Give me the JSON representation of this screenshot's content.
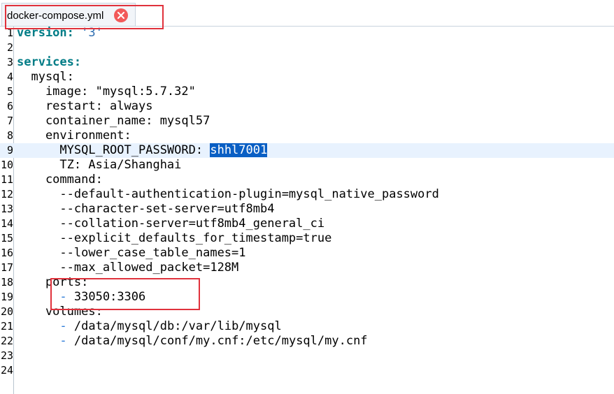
{
  "tab": {
    "label": "docker-compose.yml",
    "close_icon": "close-circle-icon"
  },
  "colors": {
    "selection": "#0a5fc4",
    "current_line": "#e8f2fe",
    "annotation_box": "#e0323c"
  },
  "lines": [
    {
      "n": "1",
      "indent": "",
      "key": "version:",
      "rest": " ",
      "str": "'3'"
    },
    {
      "n": "2",
      "text": ""
    },
    {
      "n": "3",
      "key": "services:"
    },
    {
      "n": "4",
      "text": "  mysql:"
    },
    {
      "n": "5",
      "text": "    image: \"mysql:5.7.32\""
    },
    {
      "n": "6",
      "text": "    restart: always"
    },
    {
      "n": "7",
      "text": "    container_name: mysql57"
    },
    {
      "n": "8",
      "text": "    environment:"
    },
    {
      "n": "9",
      "text": "      MYSQL_ROOT_PASSWORD: ",
      "selected": "shhl7001"
    },
    {
      "n": "10",
      "text": "      TZ: Asia/Shanghai"
    },
    {
      "n": "11",
      "text": "    command:"
    },
    {
      "n": "12",
      "text": "      --default-authentication-plugin=mysql_native_password"
    },
    {
      "n": "13",
      "text": "      --character-set-server=utf8mb4"
    },
    {
      "n": "14",
      "text": "      --collation-server=utf8mb4_general_ci"
    },
    {
      "n": "15",
      "text": "      --explicit_defaults_for_timestamp=true"
    },
    {
      "n": "16",
      "text": "      --lower_case_table_names=1"
    },
    {
      "n": "17",
      "text": "      --max_allowed_packet=128M"
    },
    {
      "n": "18",
      "text": "    ports:"
    },
    {
      "n": "19",
      "indent": "      ",
      "dash": "-",
      "after": " 33050:3306"
    },
    {
      "n": "20",
      "text": "    volumes:"
    },
    {
      "n": "21",
      "indent": "      ",
      "dash": "-",
      "after": " /data/mysql/db:/var/lib/mysql"
    },
    {
      "n": "22",
      "indent": "      ",
      "dash": "-",
      "after": " /data/mysql/conf/my.cnf:/etc/mysql/my.cnf"
    },
    {
      "n": "23",
      "text": ""
    },
    {
      "n": "24",
      "text": ""
    }
  ]
}
